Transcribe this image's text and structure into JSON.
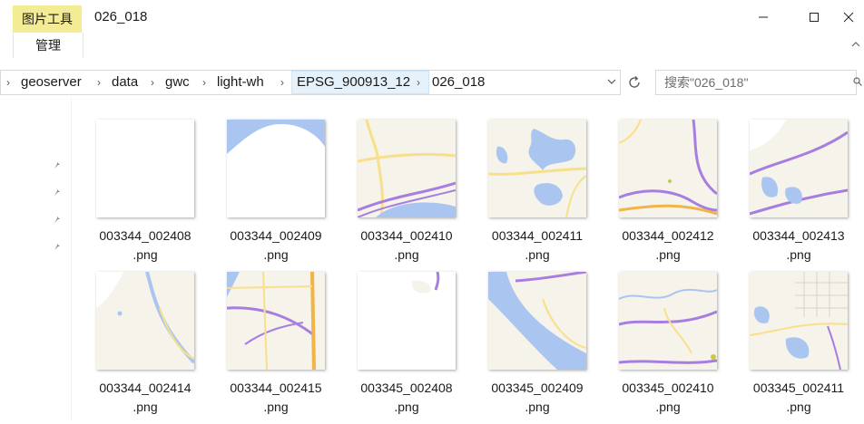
{
  "window": {
    "tool_tab": "图片工具",
    "manage_tab": "管理",
    "title": "026_018"
  },
  "address": {
    "crumbs": [
      "geoserver",
      "data",
      "gwc",
      "light-wh",
      "EPSG_900913_12",
      "026_018"
    ]
  },
  "search": {
    "placeholder": "搜索\"026_018\""
  },
  "files": [
    {
      "name_line1": "003344_002408",
      "name_line2": ".png",
      "thumb": "blank"
    },
    {
      "name_line1": "003344_002409",
      "name_line2": ".png",
      "thumb": "water-arc"
    },
    {
      "name_line1": "003344_002410",
      "name_line2": ".png",
      "thumb": "roads-lake"
    },
    {
      "name_line1": "003344_002411",
      "name_line2": ".png",
      "thumb": "lakes"
    },
    {
      "name_line1": "003344_002412",
      "name_line2": ".png",
      "thumb": "highways"
    },
    {
      "name_line1": "003344_002413",
      "name_line2": ".png",
      "thumb": "lakes-highway"
    },
    {
      "name_line1": "003344_002414",
      "name_line2": ".png",
      "thumb": "river-left"
    },
    {
      "name_line1": "003344_002415",
      "name_line2": ".png",
      "thumb": "roads-grid"
    },
    {
      "name_line1": "003345_002408",
      "name_line2": ".png",
      "thumb": "mostly-blank"
    },
    {
      "name_line1": "003345_002409",
      "name_line2": ".png",
      "thumb": "river-diagonal"
    },
    {
      "name_line1": "003345_002410",
      "name_line2": ".png",
      "thumb": "river-roads"
    },
    {
      "name_line1": "003345_002411",
      "name_line2": ".png",
      "thumb": "town-lakes"
    }
  ],
  "colors": {
    "tool_tab_bg": "#f4ec94",
    "crumb_highlight": "#e5f1fb",
    "map_land": "#f5f3ea",
    "map_water": "#a9c5f0",
    "map_road_yellow": "#f8e08a",
    "map_road_purple": "#a77ee0",
    "map_road_orange": "#f2b347"
  },
  "icons": {
    "minimize": "minimize-icon",
    "maximize": "maximize-icon",
    "close": "close-icon",
    "pin": "pin-icon",
    "refresh": "refresh-icon",
    "dropdown": "chevron-down-icon"
  }
}
